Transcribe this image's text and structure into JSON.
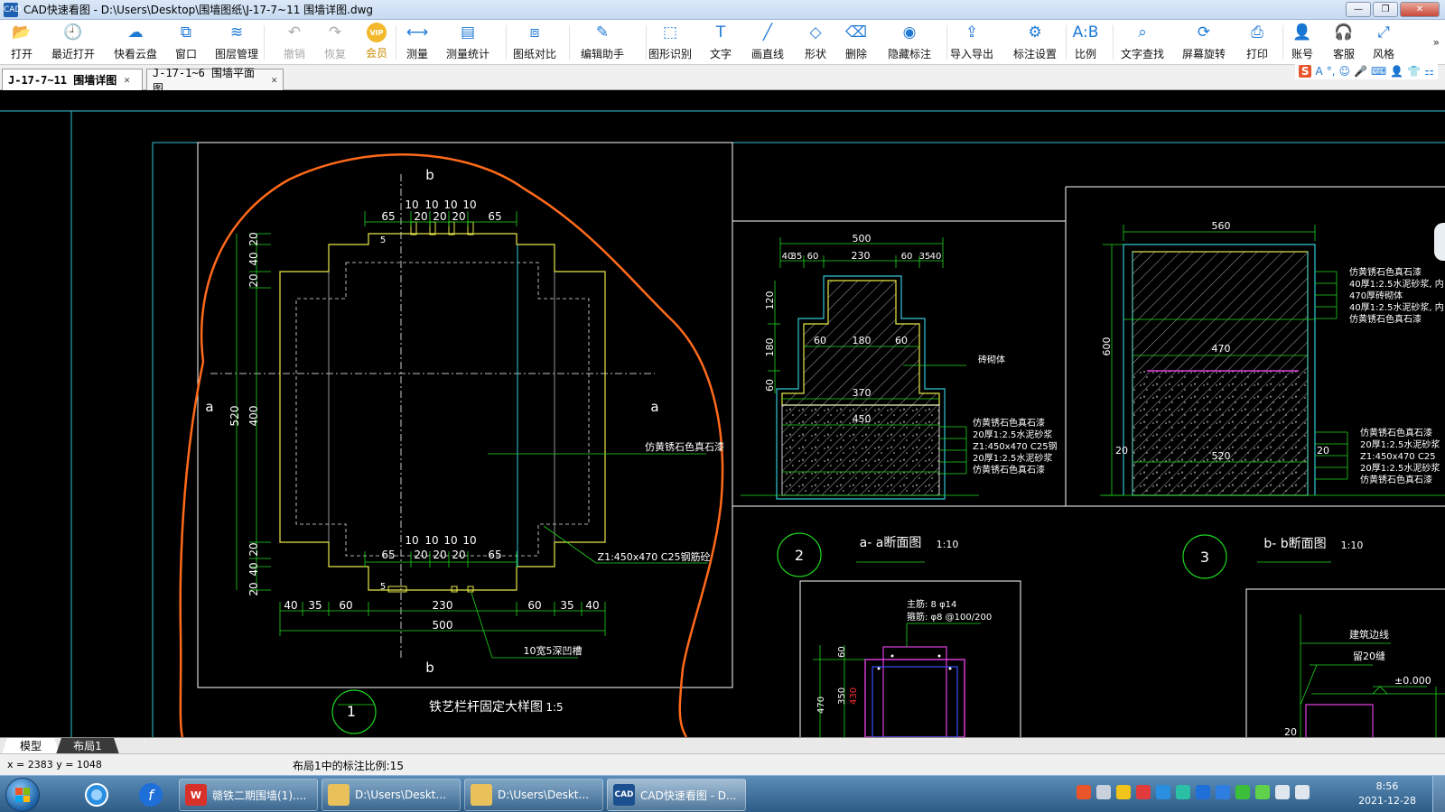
{
  "window": {
    "title": "CAD快速看图 - D:\\Users\\Desktop\\围墙图纸\\J-17-7~11 围墙详图.dwg",
    "minimize": "—",
    "maximize": "❐",
    "close": "✕"
  },
  "toolbar": [
    {
      "id": "open",
      "label": "打开",
      "icon": "folder-open",
      "glyph": "📂",
      "enabled": true
    },
    {
      "id": "recent",
      "label": "最近打开",
      "icon": "clock",
      "glyph": "🕘",
      "enabled": true
    },
    {
      "id": "cloud",
      "label": "快看云盘",
      "icon": "cloud",
      "glyph": "☁",
      "enabled": true
    },
    {
      "id": "window",
      "label": "窗口",
      "icon": "window",
      "glyph": "⧉",
      "enabled": true
    },
    {
      "id": "layers",
      "label": "图层管理",
      "icon": "layers",
      "glyph": "≋",
      "enabled": true
    },
    {
      "id": "undo",
      "label": "撤销",
      "icon": "undo",
      "glyph": "↶",
      "enabled": false
    },
    {
      "id": "redo",
      "label": "恢复",
      "icon": "redo",
      "glyph": "↷",
      "enabled": false
    },
    {
      "id": "vip",
      "label": "会员",
      "icon": "vip-badge",
      "glyph": "VIP",
      "enabled": true
    },
    {
      "id": "measure",
      "label": "测量",
      "icon": "ruler",
      "glyph": "⟷",
      "enabled": true
    },
    {
      "id": "measure-stats",
      "label": "测量统计",
      "icon": "chart",
      "glyph": "▤",
      "enabled": true
    },
    {
      "id": "compare",
      "label": "图纸对比",
      "icon": "compare",
      "glyph": "⧈",
      "enabled": true
    },
    {
      "id": "edit-helper",
      "label": "编辑助手",
      "icon": "cad-edit",
      "glyph": "✎",
      "enabled": true
    },
    {
      "id": "shape-recognize",
      "label": "图形识别",
      "icon": "shape-recognize",
      "glyph": "⬚",
      "enabled": true
    },
    {
      "id": "text",
      "label": "文字",
      "icon": "text-T",
      "glyph": "T",
      "enabled": true
    },
    {
      "id": "line",
      "label": "画直线",
      "icon": "line",
      "glyph": "╱",
      "enabled": true
    },
    {
      "id": "shape",
      "label": "形状",
      "icon": "shape",
      "glyph": "◇",
      "enabled": true
    },
    {
      "id": "delete",
      "label": "删除",
      "icon": "eraser",
      "glyph": "⌫",
      "enabled": true
    },
    {
      "id": "hide-marks",
      "label": "隐藏标注",
      "icon": "eye-hidden",
      "glyph": "◉",
      "enabled": true
    },
    {
      "id": "import-export",
      "label": "导入导出",
      "icon": "export",
      "glyph": "⇪",
      "enabled": true
    },
    {
      "id": "mark-settings",
      "label": "标注设置",
      "icon": "settings",
      "glyph": "⚙",
      "enabled": true
    },
    {
      "id": "scale",
      "label": "比例",
      "icon": "ratio",
      "glyph": "A:B",
      "enabled": true
    },
    {
      "id": "text-find",
      "label": "文字查找",
      "icon": "search-doc",
      "glyph": "⌕",
      "enabled": true
    },
    {
      "id": "rotate",
      "label": "屏幕旋转",
      "icon": "rotate-screen",
      "glyph": "⟳",
      "enabled": true
    },
    {
      "id": "print",
      "label": "打印",
      "icon": "printer",
      "glyph": "⎙",
      "enabled": true
    },
    {
      "id": "account",
      "label": "账号",
      "icon": "user",
      "glyph": "👤",
      "enabled": true
    },
    {
      "id": "service",
      "label": "客服",
      "icon": "headset",
      "glyph": "🎧",
      "enabled": true
    },
    {
      "id": "style",
      "label": "风格",
      "icon": "expand",
      "glyph": "⤢",
      "enabled": true
    }
  ],
  "toolbar_more": "»",
  "tabs": [
    {
      "label": "J-17-7~11 围墙详图",
      "active": true,
      "close": "✕"
    },
    {
      "label": "J-17-1~6 围墙平面图",
      "active": false,
      "close": "✕"
    }
  ],
  "ime": {
    "logo": "S",
    "items": [
      "A",
      "°,",
      "☺",
      "🎤",
      "⌨",
      "👤",
      "👕",
      "⚏"
    ]
  },
  "drawing": {
    "detail1": {
      "section_marks": {
        "top": "b",
        "bottom": "b",
        "left": "a",
        "right": "a"
      },
      "dims_top_small": [
        "10",
        "10",
        "10",
        "10"
      ],
      "dims_top": [
        "65",
        "20",
        "20",
        "20",
        "65"
      ],
      "dims_mid_small": [
        "10",
        "10",
        "10",
        "10"
      ],
      "dims_mid": [
        "65",
        "20",
        "20",
        "20",
        "65"
      ],
      "dim_5_top": "5",
      "dim_5_bottom": "5",
      "dims_left": [
        "20",
        "40",
        "20",
        "400",
        "20",
        "40",
        "20"
      ],
      "dim_left_total": "520",
      "dims_bottom": [
        "40",
        "35",
        "60",
        "230",
        "60",
        "35",
        "40"
      ],
      "dim_bottom_total": "500",
      "note_stone": "仿黄锈石色真石漆",
      "note_column": "Z1:450x470 C25钢筋砼",
      "note_bolt": "10宽5深凹槽",
      "circle_num": "1",
      "caption": "铁艺栏杆固定大样图",
      "caption_scale": "1:5"
    },
    "section_a": {
      "dim_total": "500",
      "dims_top": [
        "40",
        "35",
        "60",
        "230",
        "60",
        "35",
        "40"
      ],
      "dims_left": [
        "120",
        "180",
        "60"
      ],
      "dims_inner": [
        "60",
        "180",
        "60"
      ],
      "dim_370": "370",
      "dim_450": "450",
      "note_cap": "砖砌体",
      "notes": [
        "仿黄锈石色真石漆",
        "20厚1:2.5水泥砂浆",
        "Z1:450x470 C25钢",
        "20厚1:2.5水泥砂浆",
        "仿黄锈石色真石漆"
      ],
      "circle_num": "2",
      "caption": "a- a断面图",
      "caption_scale": "1:10"
    },
    "section_b": {
      "dim_top": "560",
      "dim_left": "600",
      "dim_470": "470",
      "dim_520": "520",
      "dim_20_left": "20",
      "dim_20_right": "20",
      "notes_top": [
        "仿黄锈石色真石漆",
        "40厚1:2.5水泥砂浆, 内",
        "470厚砖砌体",
        "40厚1:2.5水泥砂浆, 内",
        "仿黄锈石色真石漆"
      ],
      "notes_bottom": [
        "仿黄锈石色真石漆",
        "20厚1:2.5水泥砂浆",
        "Z1:450x470 C25",
        "20厚1:2.5水泥砂浆",
        "仿黄锈石色真石漆"
      ],
      "circle_num": "3",
      "caption": "b- b断面图",
      "caption_scale": "1:10"
    },
    "detail4": {
      "note_main": "主筋: 8 φ14",
      "note_stirrup": "箍筋: φ8 @100/200",
      "dims": [
        "60",
        "470",
        "350",
        "430"
      ]
    },
    "detail5": {
      "note_line": "建筑边线",
      "note_gap": "留20缝",
      "elevation": "±0.000",
      "dim": "20"
    }
  },
  "layout_tabs": [
    {
      "label": "模型",
      "active": true
    },
    {
      "label": "布局1",
      "active": false
    }
  ],
  "status": {
    "coords": "x = 2383  y = 1048",
    "scale_info": "布局1中的标注比例:15"
  },
  "taskbar": {
    "items": [
      {
        "label": "赣铁二期围墙(1)....",
        "icon": "W",
        "color": "#d8312a"
      },
      {
        "label": "D:\\Users\\Deskt...",
        "icon": "folder",
        "color": "#e8c15a"
      },
      {
        "label": "D:\\Users\\Deskt...",
        "icon": "folder",
        "color": "#e8c15a"
      },
      {
        "label": "CAD快速看图 - D...",
        "icon": "CAD",
        "color": "#1c4f8f",
        "active": true
      }
    ],
    "time": "8:56",
    "date": "2021-12-28"
  }
}
